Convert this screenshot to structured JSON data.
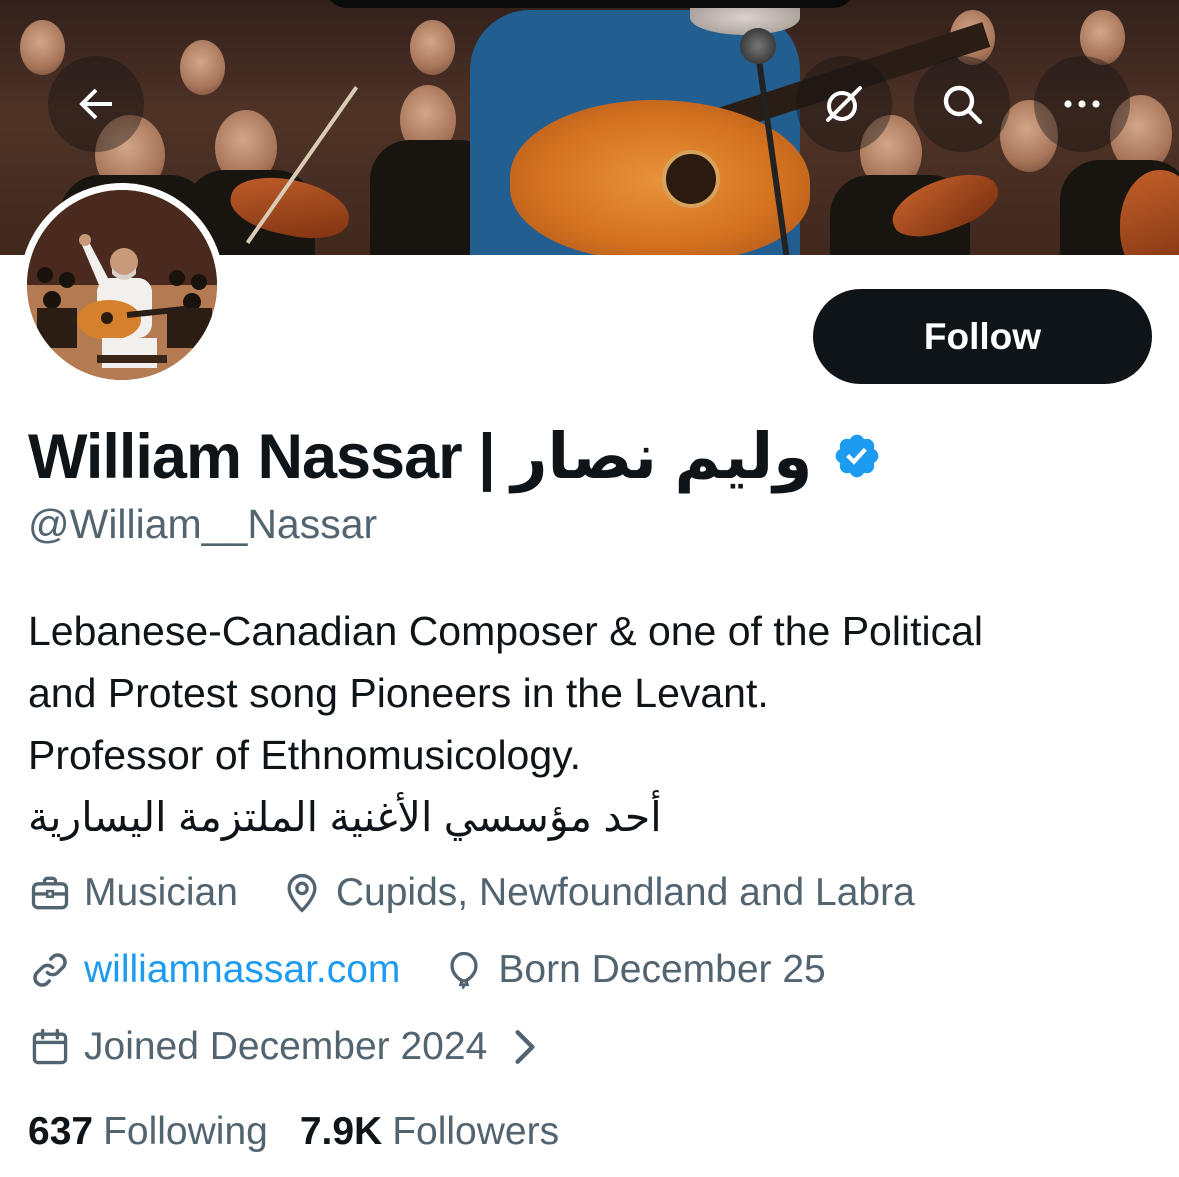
{
  "header": {
    "back_icon": "arrow-left-icon",
    "grok_icon": "grok-icon",
    "search_icon": "search-icon",
    "more_icon": "more-dots-icon"
  },
  "profile": {
    "display_name": "William Nassar | وليم نصار",
    "handle": "@William__Nassar",
    "verified": true,
    "follow_label": "Follow"
  },
  "bio": {
    "lines": [
      "Lebanese-Canadian Composer & one of the Political",
      "and Protest song Pioneers in the Levant.",
      "Professor of Ethnomusicology.",
      "أحد مؤسسي الأغنية الملتزمة اليسارية"
    ]
  },
  "meta": {
    "profession": "Musician",
    "location": "Cupids, Newfoundland and Labra",
    "website": "williamnassar.com",
    "birthday": "Born December 25",
    "joined": "Joined December 2024"
  },
  "stats": {
    "following_count": "637",
    "following_label": "Following",
    "followers_count": "7.9K",
    "followers_label": "Followers"
  },
  "colors": {
    "text_primary": "#0f1419",
    "text_secondary": "#536471",
    "link": "#1d9bf0",
    "verified": "#1d9bf0",
    "button_bg": "#0f1419"
  }
}
